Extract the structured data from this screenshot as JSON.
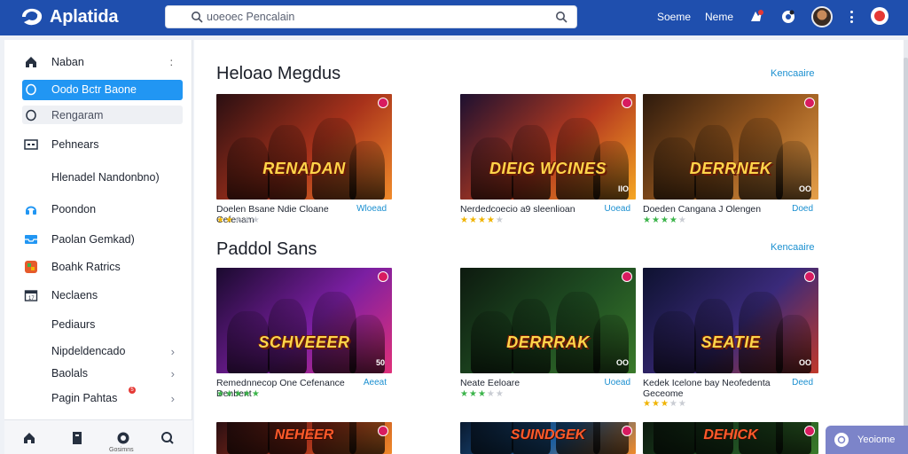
{
  "app": {
    "title": "Aplatida"
  },
  "search": {
    "placeholder": "uoeoec Pencalain"
  },
  "header": {
    "links": [
      "Soeme",
      "Neme"
    ]
  },
  "sidebar": {
    "items": [
      {
        "label": "Naban",
        "icon": "home-icon",
        "trailing": ":"
      },
      {
        "label": "Oodo Bctr Baone",
        "icon": "compass-icon",
        "active": true
      },
      {
        "label": "Rengaram",
        "icon": "circle-icon",
        "hover": true
      },
      {
        "label": "Pehnears",
        "icon": "grid-card-icon"
      },
      {
        "label": "Hlenadel Nandonbno)",
        "icon": ""
      },
      {
        "label": "Poondon",
        "icon": "headset-icon"
      },
      {
        "label": "Paolan Gemkad)",
        "icon": "inbox-icon"
      },
      {
        "label": "Boahk Ratrics",
        "icon": "apps-icon"
      },
      {
        "label": "Neclaens",
        "icon": "calendar-icon"
      },
      {
        "label": "Pediaurs",
        "icon": ""
      },
      {
        "label": "Nipdeldencado",
        "icon": "",
        "chevron": "›"
      },
      {
        "label": "Baolals",
        "icon": "",
        "chevron": "›"
      },
      {
        "label": "Pagin Pahtas",
        "icon": "",
        "chevron": "›"
      }
    ],
    "bottom_label": "Gosimns",
    "badge": "5"
  },
  "sections": [
    {
      "title": "Heloao Megdus",
      "link": "Kencaaire",
      "cards": [
        {
          "title": "Doelen Bsane Ndie Cloane Cefenam",
          "status": "Wloead",
          "stars": [
            1,
            1,
            0,
            0,
            0
          ],
          "star_color": "y",
          "poster": "RENADAN",
          "count": "",
          "theme": "sunset"
        },
        {
          "title": "Nerdedcoecio a9 sleenlioan",
          "status": "Uoead",
          "stars": [
            1,
            1,
            1,
            1,
            0
          ],
          "star_color": "y",
          "poster": "DIEIG WCINES",
          "count": "IIO",
          "theme": "mech"
        },
        {
          "title": "Doeden Cangana J Olengen",
          "status": "Doed",
          "stars": [
            1,
            1,
            1,
            1,
            0
          ],
          "star_color": "g",
          "poster": "DERRNEK",
          "count": "OO",
          "theme": "desert"
        }
      ]
    },
    {
      "title": "Paddol Sans",
      "link": "Kencaaire",
      "cards": [
        {
          "title": "Remednnecop One Cefenance Denbent",
          "status": "Aeeat",
          "stars": [
            1,
            1,
            1,
            1,
            1
          ],
          "star_color": "g",
          "poster": "SCHVEEER",
          "count": "50",
          "theme": "neon"
        },
        {
          "title": "Neate Eeloare",
          "status": "Uoead",
          "stars": [
            1,
            1,
            1,
            0,
            0
          ],
          "star_color": "g",
          "poster": "DERRRAK",
          "count": "OO",
          "theme": "jungle"
        },
        {
          "title": "Kedek Icelone bay Neofedenta Geceome",
          "status": "Deed",
          "stars": [
            1,
            1,
            1,
            0,
            0
          ],
          "star_color": "y",
          "poster": "SEATIE",
          "count": "OO",
          "theme": "space"
        }
      ]
    },
    {
      "title": "",
      "link": "",
      "cards": [
        {
          "title": "",
          "status": "",
          "poster": "NEHEER",
          "theme": "sunset"
        },
        {
          "title": "",
          "status": "",
          "poster": "SUINDGEK",
          "theme": "ocean"
        },
        {
          "title": "",
          "status": "",
          "poster": "DEHICK",
          "theme": "jungle"
        }
      ]
    }
  ],
  "fab": {
    "label": "Yeoiome"
  },
  "colors": {
    "topbar": "#1f4fae",
    "accent": "#2196f3",
    "link": "#1a8fd0"
  }
}
